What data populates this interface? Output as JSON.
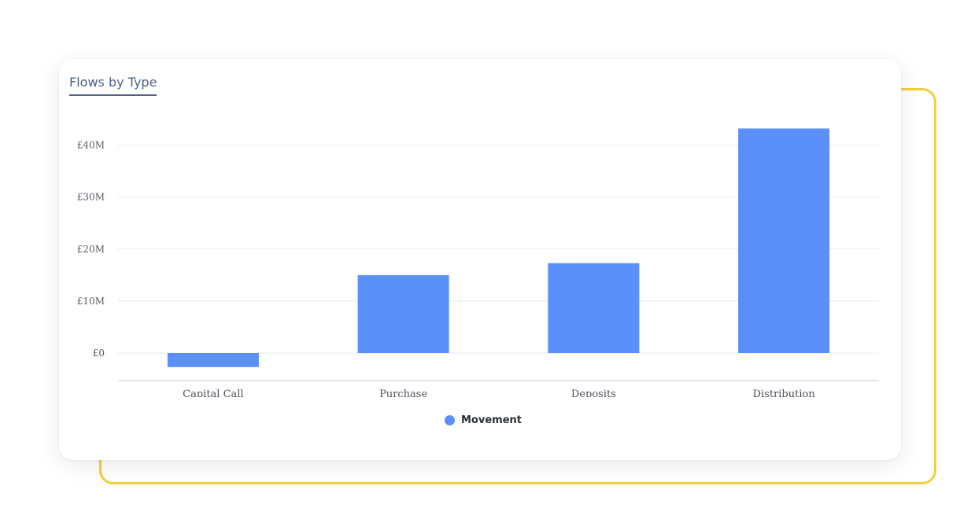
{
  "card": {
    "tab_title": "Flows by Type"
  },
  "colors": {
    "bar": "#5b8ff9",
    "grid": "#e6e8ec",
    "axis": "#c5c9cf",
    "frame_accent": "#f3cf3c",
    "tab_text": "#4f6286"
  },
  "chart_data": {
    "type": "bar",
    "categories": [
      "Capital Call",
      "Purchase",
      "Deposits",
      "Distribution"
    ],
    "series": [
      {
        "name": "Movement",
        "values": [
          -2.7,
          15.0,
          17.3,
          43.2
        ]
      }
    ],
    "title": "",
    "xlabel": "",
    "ylabel": "",
    "ylim": [
      -5,
      44
    ],
    "yticks": [
      0,
      10,
      20,
      30,
      40
    ],
    "ytick_labels": [
      "£0",
      "£10M",
      "£20M",
      "£30M",
      "£40M"
    ],
    "grid": true,
    "legend": "bottom-center"
  }
}
